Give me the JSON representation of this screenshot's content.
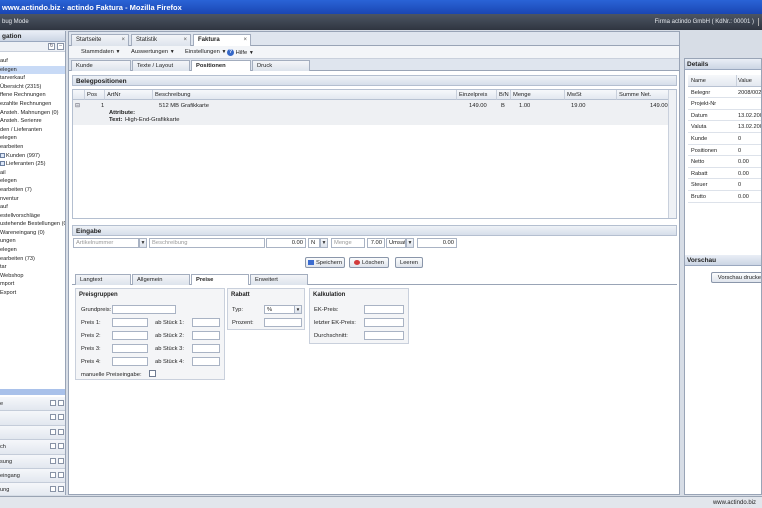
{
  "window": {
    "title": "www.actindo.biz · actindo Faktura - Mozilla Firefox"
  },
  "topbar": {
    "left": "bug Mode",
    "right": "Firma actindo GmbH ( KdNr.: 00001 )"
  },
  "sidebar": {
    "title": "gation",
    "items": [
      {
        "label": "auf"
      },
      {
        "label": "elegen",
        "selected": true
      },
      {
        "label": "tarverkauf"
      },
      {
        "label": "Übersicht (2315)"
      },
      {
        "label": "ffene Rechnungen"
      },
      {
        "label": "ezahlte Rechnungen"
      },
      {
        "label": "Ansteh. Mahnungen (0)"
      },
      {
        "label": "Ansteh. Serienre"
      },
      {
        "label": "den / Lieferanten"
      },
      {
        "label": "elegen"
      },
      {
        "label": "earbeiten"
      },
      {
        "label": "Kunden (997)",
        "icon": true
      },
      {
        "label": "Lieferanten (25)",
        "icon": true
      },
      {
        "label": "ail"
      },
      {
        "label": "elegen"
      },
      {
        "label": "earbeiten (7)"
      },
      {
        "label": "nventur"
      },
      {
        "label": "auf"
      },
      {
        "label": "estellvorschläge"
      },
      {
        "label": "ustehende Bestellungen (0)"
      },
      {
        "label": "Wareneingang (0)"
      },
      {
        "label": "ungen"
      },
      {
        "label": "elegen"
      },
      {
        "label": "earbeiten (73)"
      },
      {
        "label": "tar"
      },
      {
        "label": "Webshop"
      },
      {
        "label": "mport"
      },
      {
        "label": "Export"
      }
    ],
    "accordion": [
      {
        "label": "e"
      },
      {
        "label": ""
      },
      {
        "label": ""
      },
      {
        "label": "ch"
      },
      {
        "label": "sung"
      },
      {
        "label": "eingang"
      },
      {
        "label": "ung"
      },
      {
        "label": "te"
      },
      {
        "label": "ng"
      }
    ]
  },
  "main": {
    "tabs": [
      {
        "label": "Startseite"
      },
      {
        "label": "Statistik"
      },
      {
        "label": "Faktura",
        "active": true
      }
    ],
    "toolbar": {
      "stammdaten": "Stammdaten",
      "auswertungen": "Auswertungen",
      "einstellungen": "Einstellungen",
      "hilfe": "Hilfe"
    },
    "subtabs": [
      {
        "label": "Kunde"
      },
      {
        "label": "Texte / Layout"
      },
      {
        "label": "Positionen",
        "active": true
      },
      {
        "label": "Druck"
      }
    ],
    "positions": {
      "title": "Belegpositionen",
      "columns": [
        "Pos",
        "ArtNr",
        "Beschreibung",
        "Einzelpreis",
        "B/N",
        "Menge",
        "MwSt",
        "Summe Net."
      ],
      "rows": [
        {
          "toggle": "⊟",
          "pos": "1",
          "artnr": "",
          "beschreibung": "512 MB Grafikkarte",
          "einzelpreis": "149.00",
          "bn": "B",
          "menge": "1.00",
          "mwst": "19.00",
          "summe": "149.00",
          "attribute_label": "Attribute:",
          "text_label": "Text:",
          "text_value": "High-End-Grafikkarte"
        }
      ]
    },
    "entry": {
      "title": "Eingabe",
      "artnr_placeholder": "Artikelnummer",
      "desc_placeholder": "Beschreibung",
      "price": "0.00",
      "bn": "N",
      "qty_placeholder": "Menge",
      "vat": "7.00",
      "vat_unit": "Umsat",
      "total": "0.00",
      "save": "Speichern",
      "delete": "Löschen",
      "clear": "Leeren"
    },
    "detailtabs": [
      {
        "label": "Langtext"
      },
      {
        "label": "Allgemein"
      },
      {
        "label": "Preise",
        "active": true
      },
      {
        "label": "Erweitert"
      }
    ],
    "preisgruppen": {
      "title": "Preisgruppen",
      "grundpreis": "Grundpreis:",
      "preis1": "Preis 1:",
      "preis2": "Preis 2:",
      "preis3": "Preis 3:",
      "preis4": "Preis 4:",
      "ab1": "ab Stück 1:",
      "ab2": "ab Stück 2:",
      "ab3": "ab Stück 3:",
      "ab4": "ab Stück 4:",
      "manual": "manuelle Preiseingabe:"
    },
    "rabatt": {
      "title": "Rabatt",
      "typ": "Typ:",
      "typ_value": "%",
      "prozent": "Prozent:"
    },
    "kalkulation": {
      "title": "Kalkulation",
      "ek": "EK-Preis:",
      "letzter": "letzter EK-Preis:",
      "durchschnitt": "Durchschnitt:"
    }
  },
  "details": {
    "title": "Details",
    "columns": [
      "Name",
      "Value"
    ],
    "rows": [
      {
        "name": "Belegnr",
        "value": "2008/0028"
      },
      {
        "name": "Projekt-Nr",
        "value": ""
      },
      {
        "name": "Datum",
        "value": "13.02.2008"
      },
      {
        "name": "Valuta",
        "value": "13.02.2008"
      },
      {
        "name": "Kunde",
        "value": "0"
      },
      {
        "name": "Positionen",
        "value": "0"
      },
      {
        "name": "Netto",
        "value": "0.00"
      },
      {
        "name": "Rabatt",
        "value": "0.00"
      },
      {
        "name": "Steuer",
        "value": "0"
      },
      {
        "name": "Brutto",
        "value": "0.00"
      }
    ]
  },
  "vorschau": {
    "title": "Vorschau",
    "button": "Vorschau drucken"
  },
  "statusbar": {
    "url": "www.actindo.biz"
  }
}
